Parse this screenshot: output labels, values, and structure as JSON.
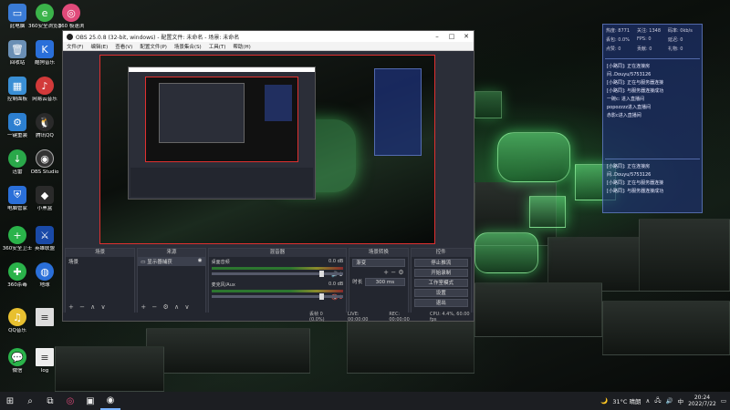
{
  "desktop_icons": [
    {
      "label": "此电脑",
      "icon": "computer-icon",
      "color": "#3a7bd5"
    },
    {
      "label": "360安全浏览器",
      "icon": "browser-icon",
      "color": "#3bb34a"
    },
    {
      "label": "360 极速浏",
      "icon": "browser-icon",
      "color": "#e04a7a"
    },
    {
      "label": "回收站",
      "icon": "recycle-bin-icon",
      "color": "#6a8fb5"
    },
    {
      "label": "酷狗音乐",
      "icon": "music-icon",
      "color": "#2a6fd9"
    },
    {
      "label": "控制面板",
      "icon": "control-panel-icon",
      "color": "#3a8fd5"
    },
    {
      "label": "网易云音乐",
      "icon": "music-icon",
      "color": "#d23a3a"
    },
    {
      "label": "一键重装",
      "icon": "tool-icon",
      "color": "#2c7fd0"
    },
    {
      "label": "腾讯QQ",
      "icon": "qq-icon",
      "color": "#2a2a2a"
    },
    {
      "label": "迅雷",
      "icon": "download-icon",
      "color": "#2aa84a"
    },
    {
      "label": "OBS Studio",
      "icon": "obs-icon",
      "color": "#333"
    },
    {
      "label": "电脑管家",
      "icon": "shield-icon",
      "color": "#2a6fd9"
    },
    {
      "label": "小黑盒",
      "icon": "app-icon",
      "color": "#2a2a2a"
    },
    {
      "label": "360安全卫士",
      "icon": "shield-icon",
      "color": "#2ab34a"
    },
    {
      "label": "英雄联盟",
      "icon": "game-icon",
      "color": "#1a4aa8"
    },
    {
      "label": "360杀毒",
      "icon": "antivirus-icon",
      "color": "#2ab34a"
    },
    {
      "label": "地球",
      "icon": "globe-icon",
      "color": "#2a6fd9"
    },
    {
      "label": "QQ音乐",
      "icon": "music-icon",
      "color": "#e8c030"
    },
    {
      "label": "",
      "icon": "document-icon",
      "color": "#ddd"
    },
    {
      "label": "微信",
      "icon": "wechat-icon",
      "color": "#2ab34a"
    },
    {
      "label": "log",
      "icon": "document-icon",
      "color": "#eee"
    }
  ],
  "obs": {
    "title": "OBS 25.0.8 (32-bit, windows) - 配置文件: 未命名 - 场景: 未命名",
    "menu": [
      "文件(F)",
      "编辑(E)",
      "查看(V)",
      "配置文件(P)",
      "场景集合(S)",
      "工具(T)",
      "帮助(H)"
    ],
    "docks": {
      "scenes_title": "场景",
      "scenes": [
        "场景"
      ],
      "sources_title": "来源",
      "sources": [
        "显示器捕获"
      ],
      "mixer_title": "混音器",
      "mixer": [
        {
          "name": "桌面音频",
          "db": "0.0 dB"
        },
        {
          "name": "麦克风/Aux",
          "db": "0.0 dB"
        }
      ],
      "transitions_title": "场景转换",
      "transition_type": "渐变",
      "duration_label": "时长",
      "duration_value": "300 ms",
      "controls_title": "控件",
      "controls": [
        "停止推流",
        "开始录制",
        "工作室模式",
        "设置",
        "退出"
      ]
    },
    "status": {
      "drop": "丢帧 0 (0.0%)",
      "live": "LIVE: 00:00:00",
      "rec": "REC: 00:00:00",
      "cpu": "CPU: 4.4%, 60.00 fps"
    }
  },
  "chat": {
    "stats": [
      "热度: 8771",
      "关注: 1348",
      "码率: 0kb/s",
      "丢包: 0.0%",
      "FPS: 0",
      "延迟: 0",
      "点赞: 0",
      "贡献: 0",
      "礼物: 0"
    ],
    "messages_top": [
      "[小路同]: 正在连接房",
      "间..Douyu/5753126",
      "[小路同]: 正在与服务器连接",
      "[小路同]: 与服务器连接成功",
      "一碗c: 进入直播间",
      "popozzzz进入直播间",
      "赤影c进入直播间"
    ],
    "messages_bottom": [
      "[小路同]: 正在连接房",
      "间..Douyu/5753126",
      "[小路同]: 正在与服务器连接",
      "[小路同]: 与服务器连接成功"
    ]
  },
  "taskbar": {
    "weather": "31°C 晴朗",
    "time": "20:24",
    "date": "2022/7/22",
    "lang": "中"
  }
}
